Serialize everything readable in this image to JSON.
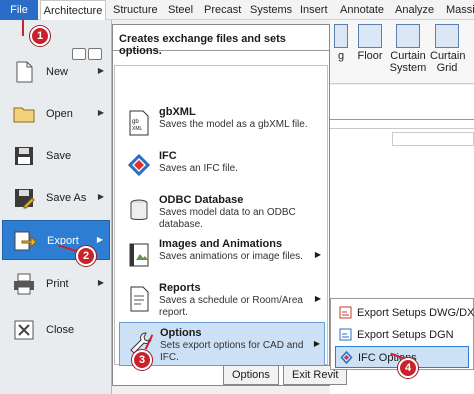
{
  "ribbon": {
    "tabs": [
      "File",
      "Architecture",
      "Structure",
      "Steel",
      "Precast",
      "Systems",
      "Insert",
      "Annotate",
      "Analyze",
      "Massin"
    ],
    "buttons": [
      {
        "label": "g",
        "icon": "wall-icon"
      },
      {
        "label": "Floor",
        "icon": "floor-icon"
      },
      {
        "label": "Curtain System",
        "icon": "curtain-system-icon"
      },
      {
        "label": "Curtain Grid",
        "icon": "curtain-grid-icon"
      }
    ]
  },
  "app_menu": {
    "items": [
      {
        "label": "New",
        "icon": "new-file-icon",
        "has_arrow": true
      },
      {
        "label": "Open",
        "icon": "open-folder-icon",
        "has_arrow": true
      },
      {
        "label": "Save",
        "icon": "save-disk-icon",
        "has_arrow": false
      },
      {
        "label": "Save As",
        "icon": "save-as-icon",
        "has_arrow": true
      },
      {
        "label": "Export",
        "icon": "export-arrow-icon",
        "has_arrow": true,
        "active": true
      },
      {
        "label": "Print",
        "icon": "printer-icon",
        "has_arrow": true
      },
      {
        "label": "Close",
        "icon": "close-doc-icon",
        "has_arrow": false
      }
    ],
    "arrow": "▶"
  },
  "submenu": {
    "header": "Creates exchange files and sets options.",
    "items": [
      {
        "title": "gbXML",
        "desc": "Saves the model as a gbXML file.",
        "icon": "gbxml-icon",
        "has_arrow": false
      },
      {
        "title": "IFC",
        "desc": "Saves an IFC file.",
        "icon": "ifc-icon",
        "has_arrow": false
      },
      {
        "title": "ODBC Database",
        "desc": "Saves model data to an ODBC database.",
        "icon": "database-icon",
        "has_arrow": false
      },
      {
        "title": "Images and Animations",
        "desc": "Saves animations or image files.",
        "icon": "film-icon",
        "has_arrow": true
      },
      {
        "title": "Reports",
        "desc": "Saves a schedule or Room/Area report.",
        "icon": "report-icon",
        "has_arrow": true
      },
      {
        "title": "Options",
        "desc": "Sets export options for CAD and IFC.",
        "icon": "wrench-icon",
        "has_arrow": true,
        "active": true
      }
    ],
    "buttons": [
      "Options",
      "Exit Revit"
    ]
  },
  "flyout": {
    "items": [
      {
        "label": "Export Setups DWG/DXF",
        "icon": "dwg-icon"
      },
      {
        "label": "Export Setups DGN",
        "icon": "dgn-icon"
      },
      {
        "label": "IFC Options",
        "icon": "ifc-small-icon",
        "active": true
      }
    ]
  },
  "markers": [
    "1",
    "2",
    "3",
    "4"
  ],
  "colors": {
    "accent": "#2d7dd2",
    "highlight": "#cce1f5",
    "marker": "#c8232c"
  }
}
